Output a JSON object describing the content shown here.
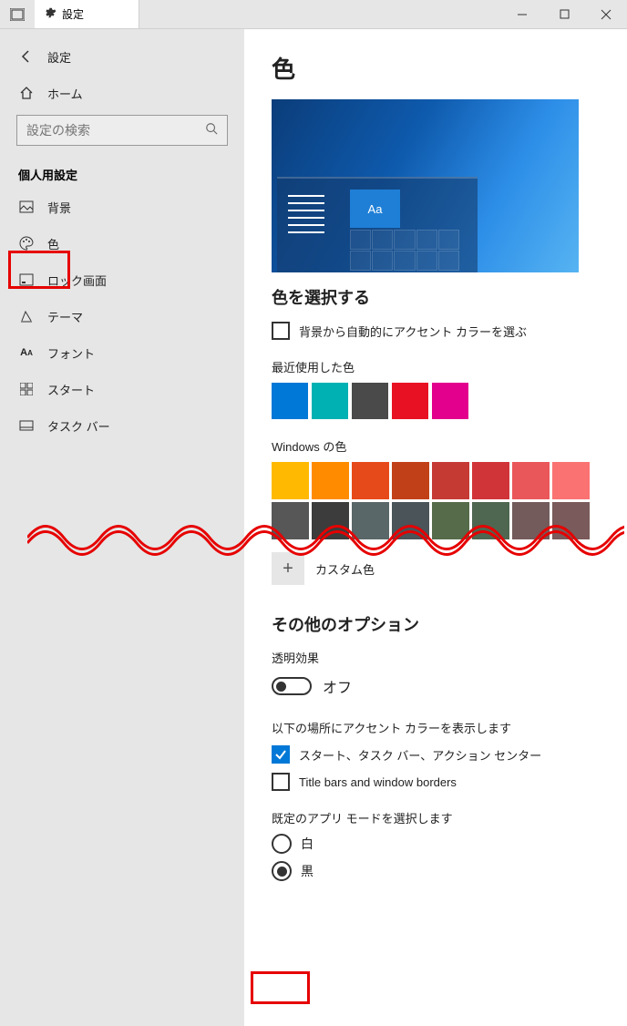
{
  "titlebar": {
    "taskview_icon": "task-view",
    "gear_icon": "gear",
    "tab_title": "設定",
    "min": "—",
    "max": "▢",
    "close": "✕"
  },
  "breadcrumb": {
    "back": "←",
    "label": "設定"
  },
  "home": {
    "label": "ホーム"
  },
  "search": {
    "placeholder": "設定の検索"
  },
  "section": "個人用設定",
  "sidebar": {
    "items": [
      {
        "label": "背景"
      },
      {
        "label": "色"
      },
      {
        "label": "ロック画面"
      },
      {
        "label": "テーマ"
      },
      {
        "label": "フォント"
      },
      {
        "label": "スタート"
      },
      {
        "label": "タスク バー"
      }
    ]
  },
  "page_title": "色",
  "preview_sample": "Aa",
  "choose_color_h": "色を選択する",
  "auto_accent": {
    "label": "背景から自動的にアクセント カラーを選ぶ",
    "checked": false
  },
  "recent_label": "最近使用した色",
  "recent_colors": [
    "#0078d7",
    "#00b1b3",
    "#4a4a4a",
    "#e81123",
    "#e3008c"
  ],
  "windows_colors_label": "Windows の色",
  "windows_colors_row1": [
    "#ffb900",
    "#ff8c00",
    "#e74a1a",
    "#c24017",
    "#c63a34",
    "#d13438",
    "#ea575a",
    "#fa7272"
  ],
  "windows_colors_row2": [
    "#575757",
    "#3c3c3c",
    "#5a6768",
    "#4a5459",
    "#556b4a",
    "#4f6650",
    "#735b5b",
    "#7a5a5a"
  ],
  "custom_color": "カスタム色",
  "other_h": "その他のオプション",
  "transparency_label": "透明効果",
  "transparency_value": "オフ",
  "accent_on_label": "以下の場所にアクセント カラーを表示します",
  "accent_start": {
    "label": "スタート、タスク バー、アクション センター",
    "checked": true
  },
  "accent_titlebar": {
    "label": "Title bars and window borders",
    "checked": false
  },
  "default_mode_label": "既定のアプリ モードを選択します",
  "mode_white": "白",
  "mode_black": "黒"
}
